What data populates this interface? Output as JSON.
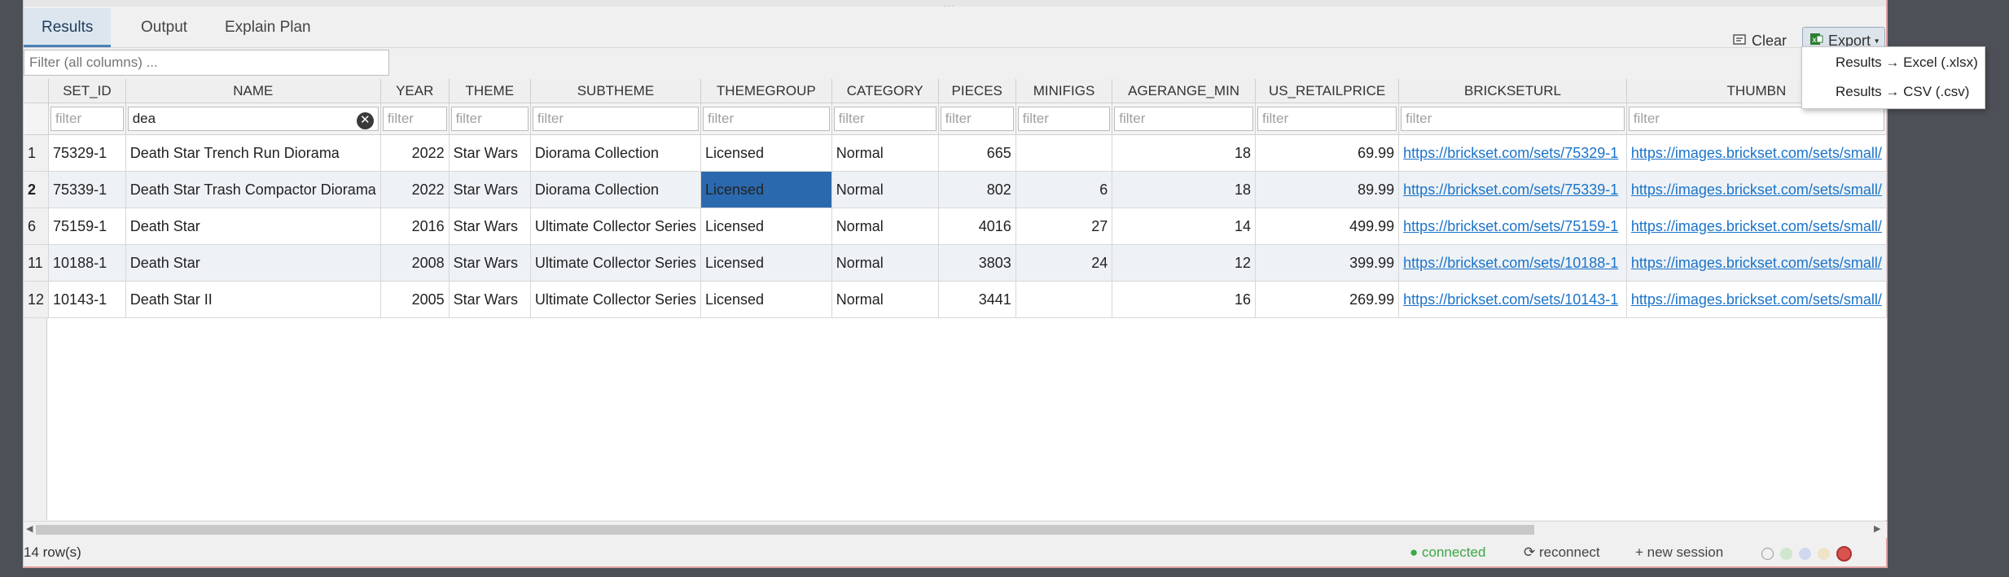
{
  "tabs": [
    {
      "label": "Results",
      "active": true
    },
    {
      "label": "Output",
      "active": false
    },
    {
      "label": "Explain Plan",
      "active": false
    }
  ],
  "toolbar": {
    "clear_label": "Clear",
    "export_label": "Export"
  },
  "export_menu": [
    "Results → Excel (.xlsx)",
    "Results → CSV (.csv)"
  ],
  "global_filter": {
    "placeholder": "Filter (all columns) ...",
    "value": ""
  },
  "columns": [
    "SET_ID",
    "NAME",
    "YEAR",
    "THEME",
    "SUBTHEME",
    "THEMEGROUP",
    "CATEGORY",
    "PIECES",
    "MINIFIGS",
    "AGERANGE_MIN",
    "US_RETAILPRICE",
    "BRICKSETURL",
    "THUMBN"
  ],
  "column_filters": {
    "placeholder": "filter",
    "name_value": "dea"
  },
  "rows": [
    {
      "rownum": "1",
      "SET_ID": "75329-1",
      "NAME": "Death Star Trench Run Diorama",
      "YEAR": "2022",
      "THEME": "Star Wars",
      "SUBTHEME": "Diorama Collection",
      "THEMEGROUP": "Licensed",
      "CATEGORY": "Normal",
      "PIECES": "665",
      "MINIFIGS": "",
      "AGERANGE_MIN": "18",
      "US_RETAILPRICE": "69.99",
      "BRICKSETURL": "https://brickset.com/sets/75329-1",
      "THUMBNAIL": "https://images.brickset.com/sets/small/"
    },
    {
      "rownum": "2",
      "SET_ID": "75339-1",
      "NAME": "Death Star Trash Compactor Diorama",
      "YEAR": "2022",
      "THEME": "Star Wars",
      "SUBTHEME": "Diorama Collection",
      "THEMEGROUP": "Licensed",
      "CATEGORY": "Normal",
      "PIECES": "802",
      "MINIFIGS": "6",
      "AGERANGE_MIN": "18",
      "US_RETAILPRICE": "89.99",
      "BRICKSETURL": "https://brickset.com/sets/75339-1",
      "THUMBNAIL": "https://images.brickset.com/sets/small/"
    },
    {
      "rownum": "6",
      "SET_ID": "75159-1",
      "NAME": "Death Star",
      "YEAR": "2016",
      "THEME": "Star Wars",
      "SUBTHEME": "Ultimate Collector Series",
      "THEMEGROUP": "Licensed",
      "CATEGORY": "Normal",
      "PIECES": "4016",
      "MINIFIGS": "27",
      "AGERANGE_MIN": "14",
      "US_RETAILPRICE": "499.99",
      "BRICKSETURL": "https://brickset.com/sets/75159-1",
      "THUMBNAIL": "https://images.brickset.com/sets/small/"
    },
    {
      "rownum": "11",
      "SET_ID": "10188-1",
      "NAME": "Death Star",
      "YEAR": "2008",
      "THEME": "Star Wars",
      "SUBTHEME": "Ultimate Collector Series",
      "THEMEGROUP": "Licensed",
      "CATEGORY": "Normal",
      "PIECES": "3803",
      "MINIFIGS": "24",
      "AGERANGE_MIN": "12",
      "US_RETAILPRICE": "399.99",
      "BRICKSETURL": "https://brickset.com/sets/10188-1",
      "THUMBNAIL": "https://images.brickset.com/sets/small/"
    },
    {
      "rownum": "12",
      "SET_ID": "10143-1",
      "NAME": "Death Star II",
      "YEAR": "2005",
      "THEME": "Star Wars",
      "SUBTHEME": "Ultimate Collector Series",
      "THEMEGROUP": "Licensed",
      "CATEGORY": "Normal",
      "PIECES": "3441",
      "MINIFIGS": "",
      "AGERANGE_MIN": "16",
      "US_RETAILPRICE": "269.99",
      "BRICKSETURL": "https://brickset.com/sets/10143-1",
      "THUMBNAIL": "https://images.brickset.com/sets/small/"
    }
  ],
  "status": {
    "row_count": "14 row(s)",
    "connected": "● connected",
    "reconnect": "⟳ reconnect",
    "new_session": "+ new session"
  },
  "colors": {
    "accent": "#2b69ae",
    "connected": "#3aa845",
    "link": "#1a73c9"
  },
  "icons": [
    "export-icon",
    "clear-icon",
    "clear-filter-icon",
    "reconnect-icon"
  ]
}
